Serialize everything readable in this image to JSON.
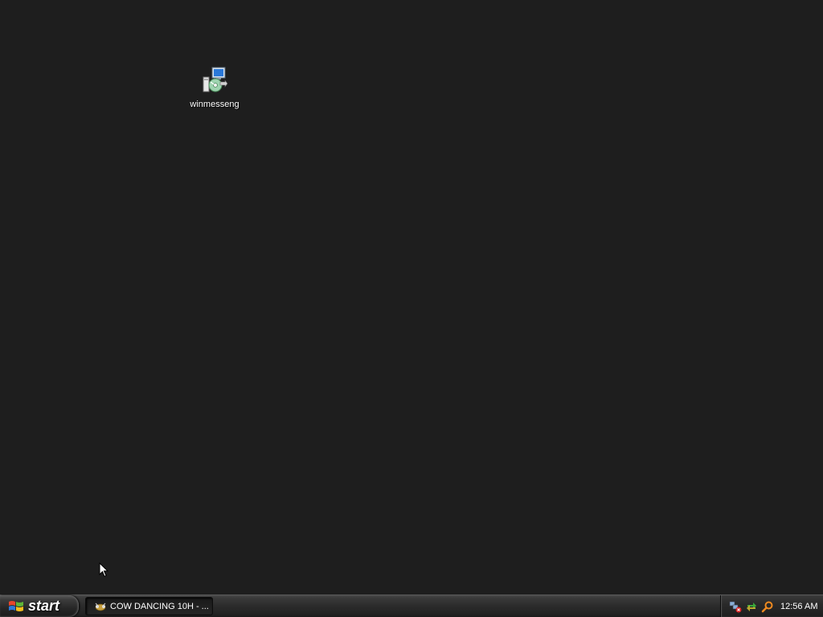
{
  "desktop": {
    "background_color": "#1e1e1e",
    "icons": [
      {
        "label": "winmesseng",
        "icon": "installer-package-icon"
      }
    ]
  },
  "taskbar": {
    "start_label": "start",
    "tasks": [
      {
        "label": "COW DANCING 10H - ...",
        "icon": "media-player-icon",
        "active": true
      }
    ],
    "tray": {
      "icons": [
        "network-disconnected-icon",
        "sync-arrows-icon",
        "search-icon"
      ],
      "clock": "12:56 AM"
    }
  }
}
